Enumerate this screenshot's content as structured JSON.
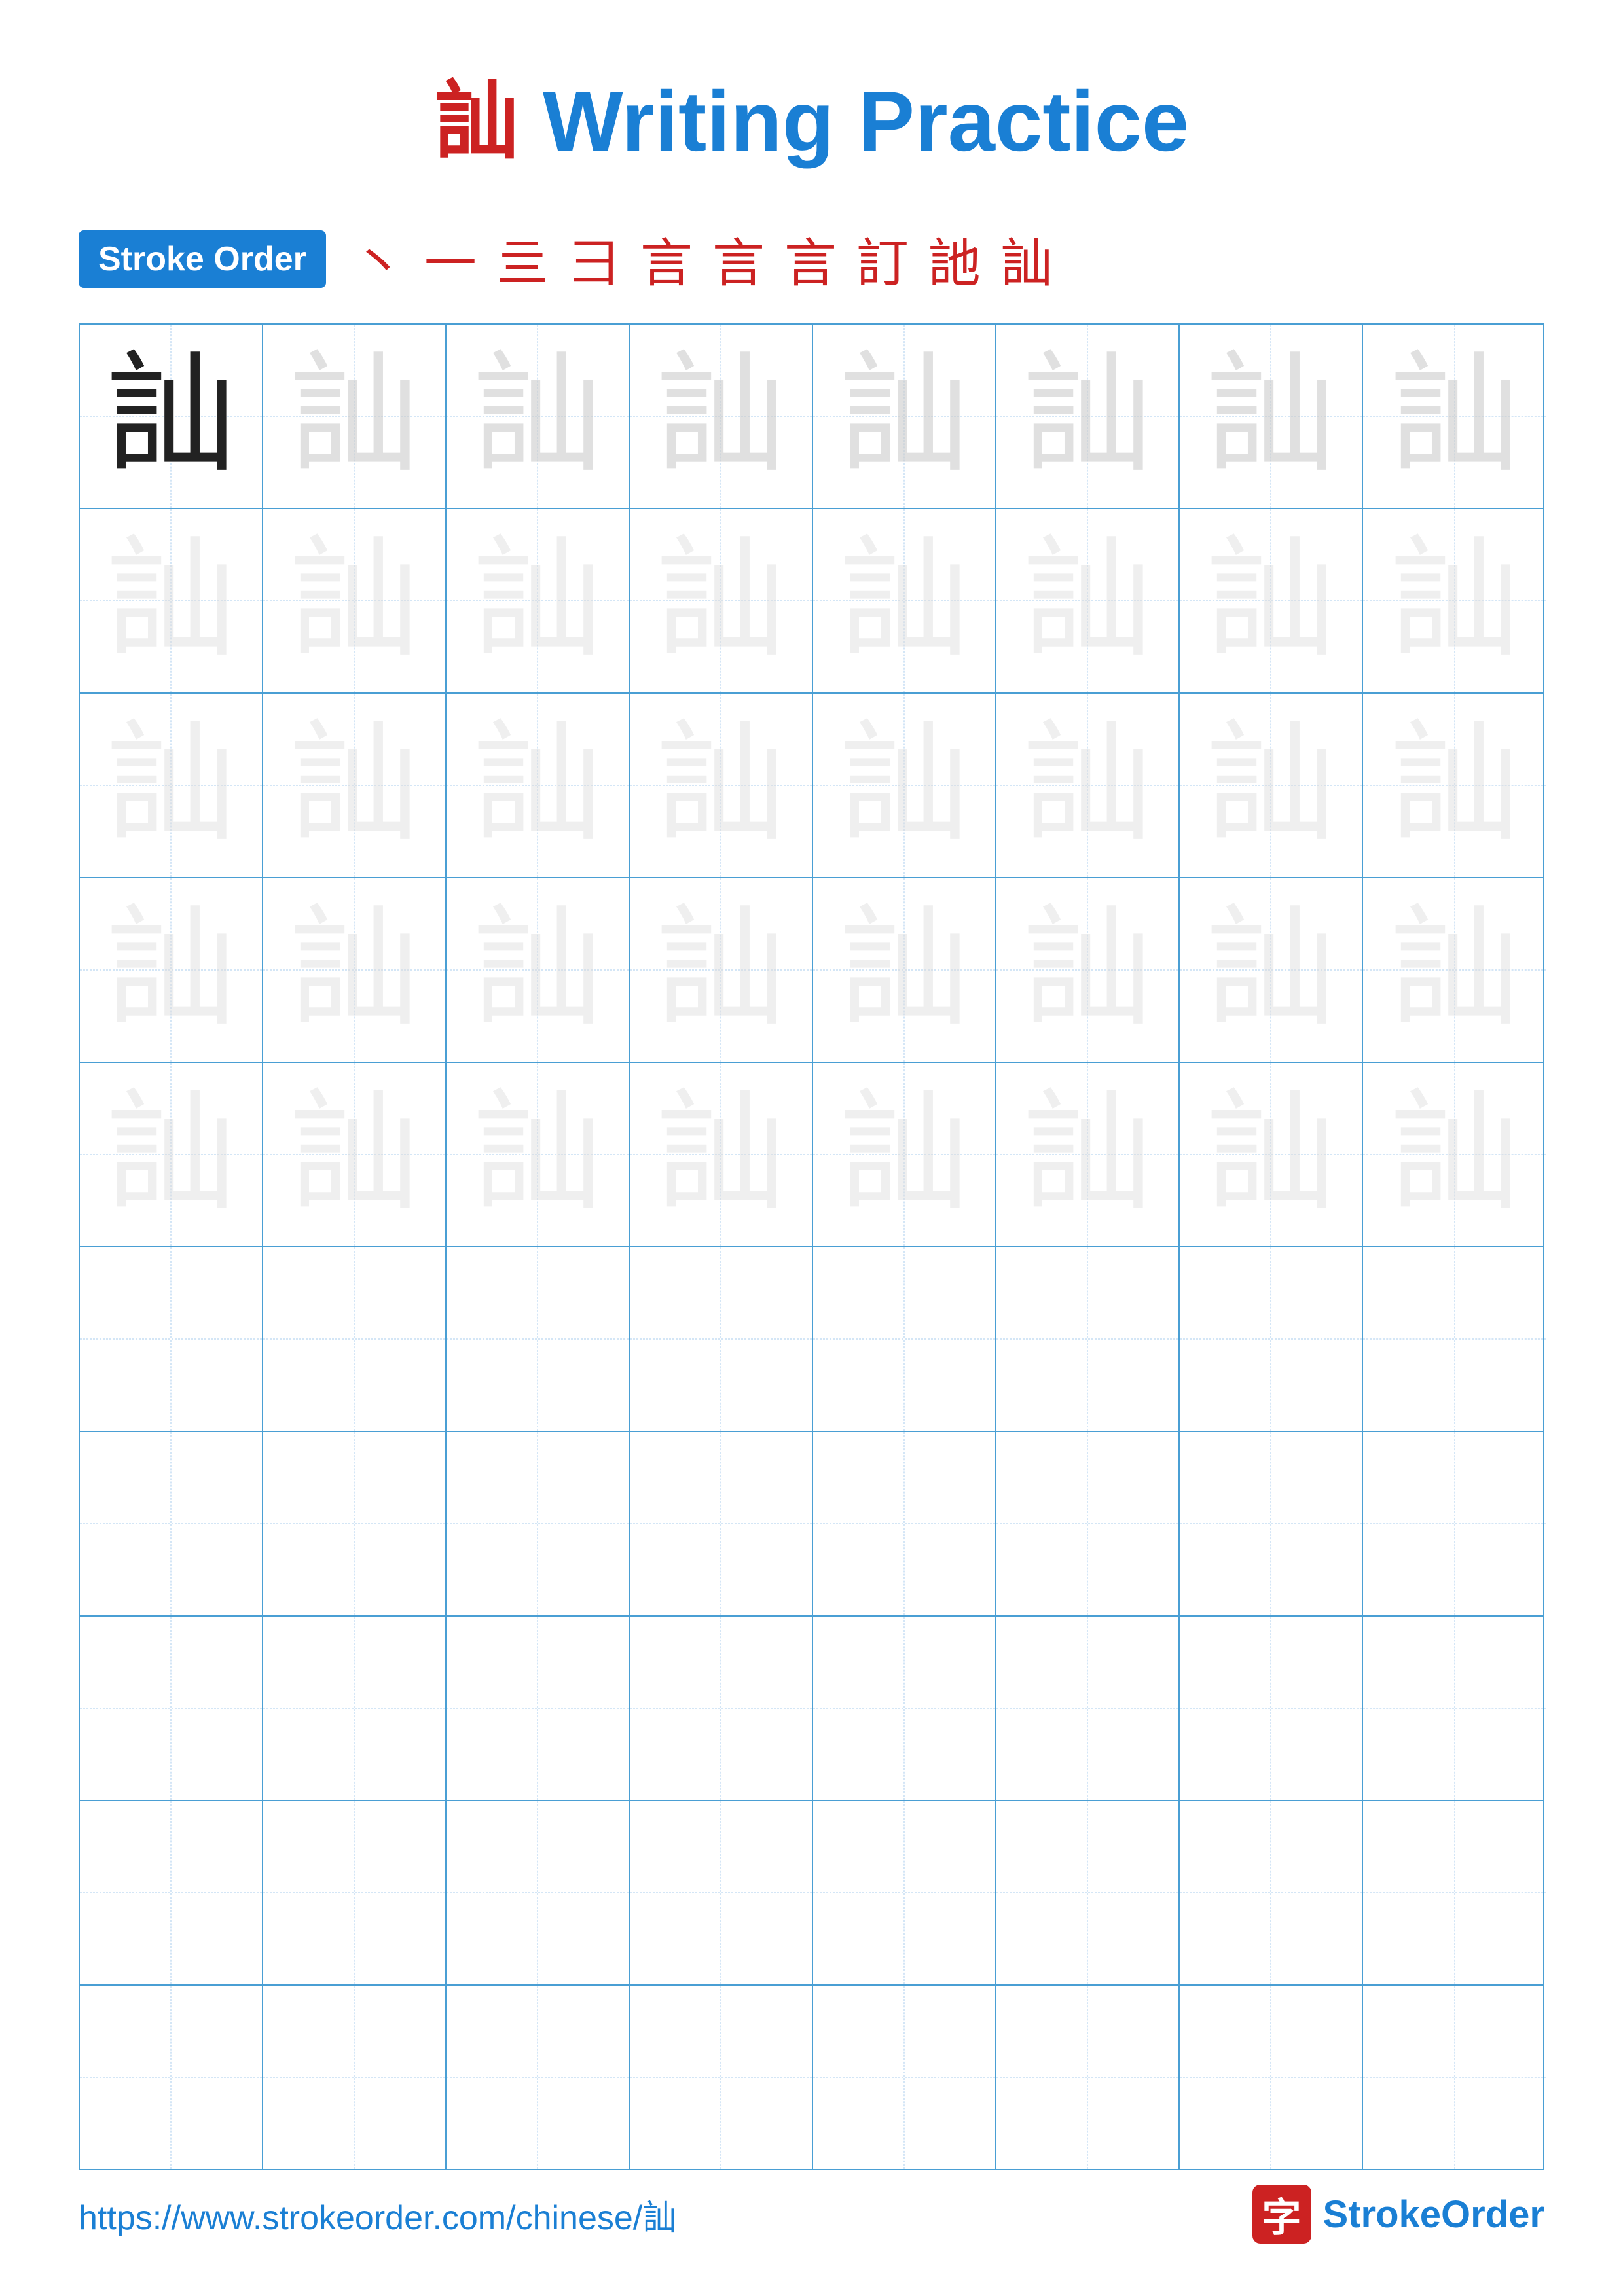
{
  "title": {
    "character": "訕",
    "label": "Writing Practice",
    "full": "訕 Writing Practice"
  },
  "stroke_order": {
    "badge_label": "Stroke Order",
    "strokes": [
      "丶",
      "一",
      "三",
      "三",
      "言",
      "言",
      "言",
      "訂",
      "訑",
      "訕"
    ]
  },
  "grid": {
    "character": "訕",
    "rows": 10,
    "cols": 8,
    "practice_rows": 5,
    "empty_rows": 5
  },
  "footer": {
    "url": "https://www.strokeorder.com/chinese/訕",
    "logo_char": "字",
    "logo_name": "StrokeOrder"
  }
}
